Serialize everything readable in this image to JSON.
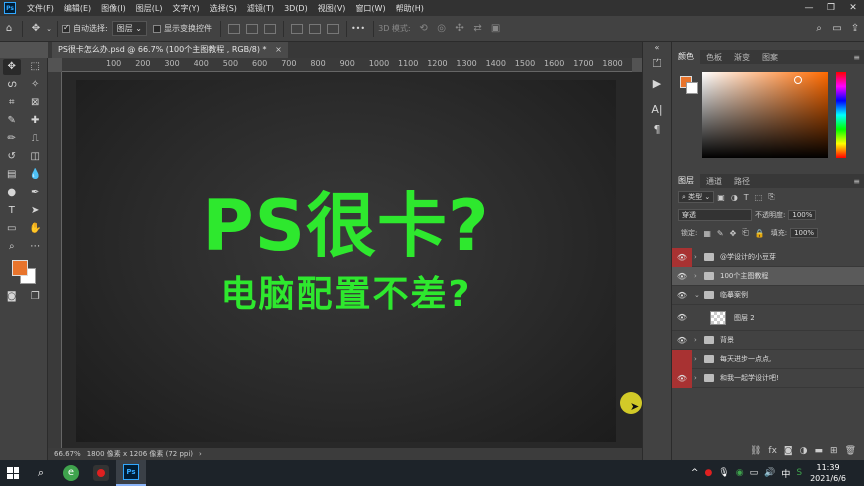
{
  "menubar": {
    "logo": "Ps",
    "items": [
      "文件(F)",
      "编辑(E)",
      "图像(I)",
      "图层(L)",
      "文字(Y)",
      "选择(S)",
      "滤镜(T)",
      "3D(D)",
      "视图(V)",
      "窗口(W)",
      "帮助(H)"
    ],
    "controls": [
      "—",
      "❐",
      "✕"
    ]
  },
  "options": {
    "auto_select_label": "自动选择:",
    "auto_select_value": "图层",
    "transform_label": "显示变换控件",
    "more": "•••",
    "mode_3d": "3D 模式:"
  },
  "document": {
    "tab_title": "PS很卡怎么办.psd @ 66.7% (100个主图教程 , RGB/8) *",
    "close": "×",
    "headline1": "PS很卡?",
    "headline2": "电脑配置不差?",
    "zoom": "66.67%",
    "size_info": "1800 像素 x 1206 像素 (72 ppi)"
  },
  "ruler": {
    "top_labels": [
      "100",
      "200",
      "300",
      "400",
      "500",
      "600",
      "700",
      "800",
      "900",
      "1000",
      "1100",
      "1200",
      "1300",
      "1400",
      "1500",
      "1600",
      "1700",
      "1800"
    ]
  },
  "color_panel": {
    "tabs": [
      "颜色",
      "色板",
      "渐变",
      "图案"
    ],
    "foreground": "#e8742c",
    "background": "#ffffff"
  },
  "layers_panel": {
    "tabs": [
      "图层",
      "通道",
      "路径"
    ],
    "filter_label": "类型",
    "blend_mode": "穿透",
    "opacity_label": "不透明度:",
    "opacity_value": "100%",
    "lock_label": "锁定:",
    "fill_label": "填充:",
    "fill_value": "100%",
    "layers": [
      {
        "name": "@学设计的小豆芽"
      },
      {
        "name": "100个主图教程"
      },
      {
        "name": "临摹案例"
      },
      {
        "name": "图层 2"
      },
      {
        "name": "背景"
      },
      {
        "name": "每天进步一点点,"
      },
      {
        "name": "和我一起学设计吧!"
      }
    ]
  },
  "taskbar": {
    "time": "11:39",
    "date": "2021/6/6",
    "ime": "中"
  }
}
